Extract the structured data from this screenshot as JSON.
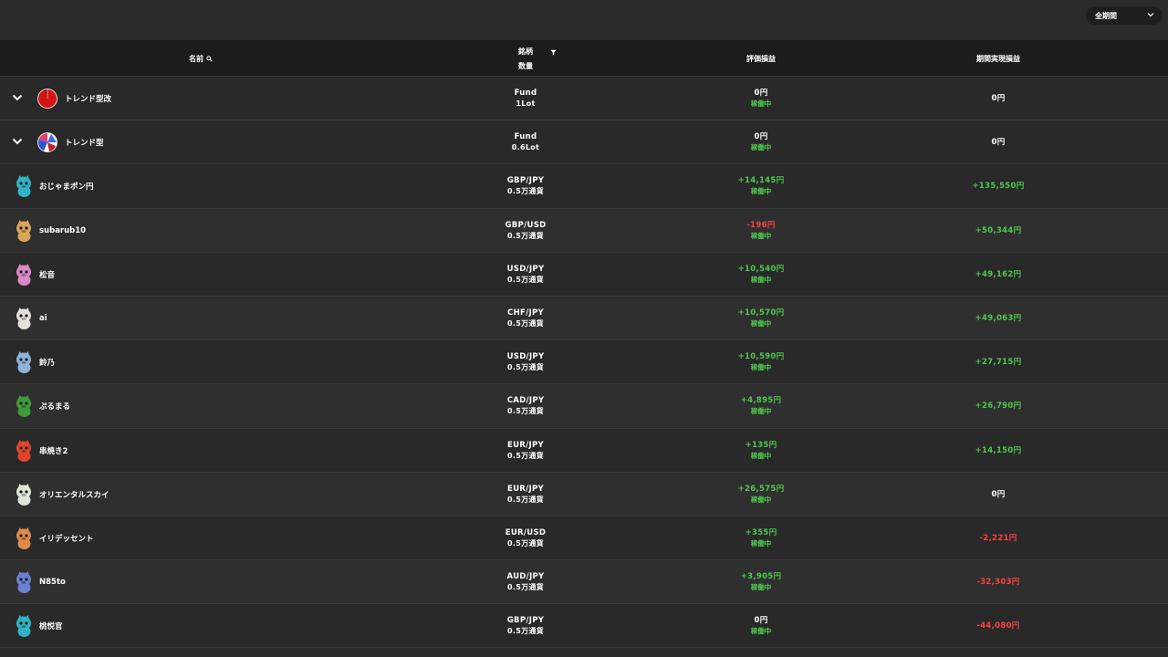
{
  "period_select": {
    "value": "全期間"
  },
  "header": {
    "name": "名前",
    "symbol": "銘柄",
    "quantity": "数量",
    "evaluation": "評価損益",
    "realized": "期間実現損益"
  },
  "colors": {
    "positive": "#4cc94c",
    "negative": "#ff4040",
    "neutral": "#ffffff"
  },
  "rows": [
    {
      "kind": "group",
      "name": "トレンド型改",
      "icon": "fund-pie-red-icon",
      "symbol": "Fund",
      "quantity": "1Lot",
      "eval": "0円",
      "eval_sign": "neutral",
      "status": "稼働中",
      "realized": "0円",
      "real_sign": "neutral"
    },
    {
      "kind": "group",
      "name": "トレンド型",
      "icon": "fund-pie-multi-icon",
      "symbol": "Fund",
      "quantity": "0.6Lot",
      "eval": "0円",
      "eval_sign": "neutral",
      "status": "稼働中",
      "realized": "0円",
      "real_sign": "neutral"
    },
    {
      "kind": "bot",
      "name": "おじゃまポン円",
      "icon": "teal-dragon-avatar-icon",
      "avatar_color": "#2fb3c4",
      "symbol": "GBP/JPY",
      "quantity": "0.5万通貨",
      "eval": "+14,145円",
      "eval_sign": "positive",
      "status": "稼働中",
      "realized": "+135,550円",
      "real_sign": "positive"
    },
    {
      "kind": "bot",
      "name": "subarub10",
      "icon": "mushroom-avatar-icon",
      "avatar_color": "#d9a55a",
      "symbol": "GBP/USD",
      "quantity": "0.5万通貨",
      "eval": "-196円",
      "eval_sign": "negative",
      "status": "稼働中",
      "realized": "+50,344円",
      "real_sign": "positive"
    },
    {
      "kind": "bot",
      "name": "松音",
      "icon": "pink-creature-avatar-icon",
      "avatar_color": "#d98ac6",
      "symbol": "USD/JPY",
      "quantity": "0.5万通貨",
      "eval": "+10,540円",
      "eval_sign": "positive",
      "status": "稼働中",
      "realized": "+49,162円",
      "real_sign": "positive"
    },
    {
      "kind": "bot",
      "name": "ai",
      "icon": "bird-avatar-icon",
      "avatar_color": "#e6e0da",
      "symbol": "CHF/JPY",
      "quantity": "0.5万通貨",
      "eval": "+10,570円",
      "eval_sign": "positive",
      "status": "稼働中",
      "realized": "+49,063円",
      "real_sign": "positive"
    },
    {
      "kind": "bot",
      "name": "鈴乃",
      "icon": "blue-blob-avatar-icon",
      "avatar_color": "#8fb4d9",
      "symbol": "USD/JPY",
      "quantity": "0.5万通貨",
      "eval": "+10,590円",
      "eval_sign": "positive",
      "status": "稼働中",
      "realized": "+27,715円",
      "real_sign": "positive"
    },
    {
      "kind": "bot",
      "name": "ぷるまる",
      "icon": "green-dragon-avatar-icon",
      "avatar_color": "#3e9a3a",
      "symbol": "CAD/JPY",
      "quantity": "0.5万通貨",
      "eval": "+4,895円",
      "eval_sign": "positive",
      "status": "稼働中",
      "realized": "+26,790円",
      "real_sign": "positive"
    },
    {
      "kind": "bot",
      "name": "串焼き2",
      "icon": "red-bird-avatar-icon",
      "avatar_color": "#e0442c",
      "symbol": "EUR/JPY",
      "quantity": "0.5万通貨",
      "eval": "+135円",
      "eval_sign": "positive",
      "status": "稼働中",
      "realized": "+14,150円",
      "real_sign": "positive"
    },
    {
      "kind": "bot",
      "name": "オリエンタルスカイ",
      "icon": "white-dino-avatar-icon",
      "avatar_color": "#dfe6d9",
      "symbol": "EUR/JPY",
      "quantity": "0.5万通貨",
      "eval": "+26,575円",
      "eval_sign": "positive",
      "status": "稼働中",
      "realized": "0円",
      "real_sign": "neutral"
    },
    {
      "kind": "bot",
      "name": "イリデッセント",
      "icon": "fox-avatar-icon",
      "avatar_color": "#e08a4a",
      "symbol": "EUR/USD",
      "quantity": "0.5万通貨",
      "eval": "+355円",
      "eval_sign": "positive",
      "status": "稼働中",
      "realized": "-2,221円",
      "real_sign": "negative"
    },
    {
      "kind": "bot",
      "name": "N85to",
      "icon": "blue-fox-avatar-icon",
      "avatar_color": "#6c7fd0",
      "symbol": "AUD/JPY",
      "quantity": "0.5万通貨",
      "eval": "+3,905円",
      "eval_sign": "positive",
      "status": "稼働中",
      "realized": "-32,303円",
      "real_sign": "negative"
    },
    {
      "kind": "bot",
      "name": "桃悦官",
      "icon": "teal-dragon-avatar-icon",
      "avatar_color": "#2fb3c4",
      "symbol": "GBP/JPY",
      "quantity": "0.5万通貨",
      "eval": "0円",
      "eval_sign": "neutral",
      "status": "稼働中",
      "realized": "-44,080円",
      "real_sign": "negative"
    }
  ]
}
